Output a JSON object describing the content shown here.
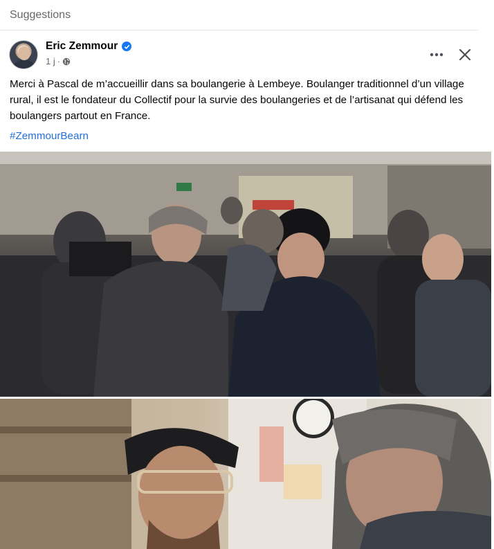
{
  "section": {
    "title": "Suggestions"
  },
  "post": {
    "author": "Eric Zemmour",
    "verified_icon": "verified-badge-icon",
    "time": "1 j",
    "separator": "·",
    "audience_icon": "globe-icon",
    "text": "Merci à Pascal de m’accueillir dans sa boulangerie à Lembeye. Boulanger traditionnel d’un village rural, il est le fondateur du Collectif pour la survie des boulangeries et de l’artisanat qui défend les boulangers partout en France.",
    "hashtag": "#ZemmourBearn"
  },
  "icons": {
    "more": "more-options-icon",
    "close": "close-icon"
  },
  "colors": {
    "link": "#216fdb",
    "verified": "#1877f2",
    "muted": "#65676b"
  }
}
